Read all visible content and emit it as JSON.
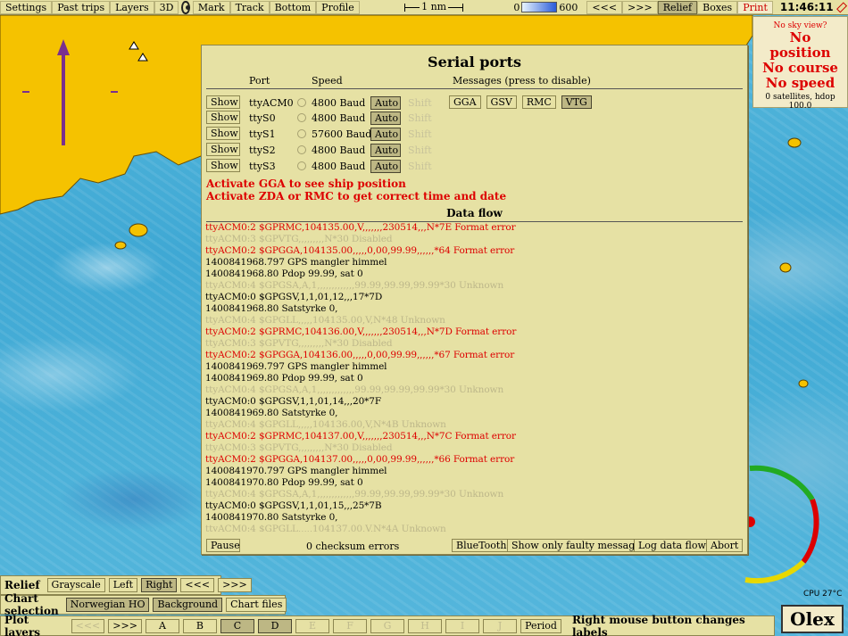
{
  "toolbar": {
    "buttons": [
      "Settings",
      "Past trips",
      "Layers",
      "3D",
      "Mark",
      "Track",
      "Bottom",
      "Profile"
    ],
    "scale_label": "1 nm",
    "depth_min": "0",
    "depth_max": "600",
    "nav_back": "<<<",
    "nav_fwd": ">>>",
    "relief": "Relief",
    "boxes": "Boxes",
    "print": "Print",
    "time": "11:46:11"
  },
  "status": {
    "sky": "No sky view?",
    "line1": "No",
    "line2": "position",
    "line3": "No course",
    "line4": "No speed",
    "satellites": "0 satellites, hdop 100.0"
  },
  "dialog": {
    "title": "Serial ports",
    "headers": {
      "port": "Port",
      "speed": "Speed",
      "messages": "Messages (press to disable)"
    },
    "ports": [
      {
        "show": "Show",
        "name": "ttyACM0",
        "speed": "4800 Baud",
        "auto": "Auto",
        "shift": "Shift"
      },
      {
        "show": "Show",
        "name": "ttyS0",
        "speed": "4800 Baud",
        "auto": "Auto",
        "shift": "Shift"
      },
      {
        "show": "Show",
        "name": "ttyS1",
        "speed": "57600 Baud",
        "auto": "Auto",
        "shift": "Shift"
      },
      {
        "show": "Show",
        "name": "ttyS2",
        "speed": "4800 Baud",
        "auto": "Auto",
        "shift": "Shift"
      },
      {
        "show": "Show",
        "name": "ttyS3",
        "speed": "4800 Baud",
        "auto": "Auto",
        "shift": "Shift"
      }
    ],
    "messages": [
      "GGA",
      "GSV",
      "RMC",
      "VTG"
    ],
    "warning1": "Activate GGA to see ship position",
    "warning2": "Activate ZDA or RMC to get correct time and date",
    "flow_title": "Data flow",
    "flow": [
      {
        "t": "ttyACM0:2 $GPRMC,104135.00,V,,,,,,,230514,,,N*7E  Format error",
        "c": "red"
      },
      {
        "t": "ttyACM0:3 $GPVTG,,,,,,,,,N*30  Disabled",
        "c": "grey"
      },
      {
        "t": "ttyACM0:2 $GPGGA,104135.00,,,,,0,00,99.99,,,,,,*64  Format error",
        "c": "red"
      },
      {
        "t": "1400841968.797 GPS mangler himmel",
        "c": "black"
      },
      {
        "t": "1400841968.80 Pdop 99.99, sat 0",
        "c": "black"
      },
      {
        "t": "ttyACM0:4 $GPGSA,A,1,,,,,,,,,,,,,99.99,99.99,99.99*30  Unknown",
        "c": "grey"
      },
      {
        "t": "ttyACM0:0 $GPGSV,1,1,01,12,,,17*7D",
        "c": "black"
      },
      {
        "t": "1400841968.80 Satstyrke 0,",
        "c": "black"
      },
      {
        "t": "ttyACM0:4 $GPGLL,,,,,104135.00,V,N*48  Unknown",
        "c": "grey"
      },
      {
        "t": "ttyACM0:2 $GPRMC,104136.00,V,,,,,,,230514,,,N*7D  Format error",
        "c": "red"
      },
      {
        "t": "ttyACM0:3 $GPVTG,,,,,,,,,N*30  Disabled",
        "c": "grey"
      },
      {
        "t": "ttyACM0:2 $GPGGA,104136.00,,,,,0,00,99.99,,,,,,*67  Format error",
        "c": "red"
      },
      {
        "t": "1400841969.797 GPS mangler himmel",
        "c": "black"
      },
      {
        "t": "1400841969.80 Pdop 99.99, sat 0",
        "c": "black"
      },
      {
        "t": "ttyACM0:4 $GPGSA,A,1,,,,,,,,,,,,,99.99,99.99,99.99*30  Unknown",
        "c": "grey"
      },
      {
        "t": "ttyACM0:0 $GPGSV,1,1,01,14,,,20*7F",
        "c": "black"
      },
      {
        "t": "1400841969.80 Satstyrke 0,",
        "c": "black"
      },
      {
        "t": "ttyACM0:4 $GPGLL,,,,,104136.00,V,N*4B  Unknown",
        "c": "grey"
      },
      {
        "t": "ttyACM0:2 $GPRMC,104137.00,V,,,,,,,230514,,,N*7C  Format error",
        "c": "red"
      },
      {
        "t": "ttyACM0:3 $GPVTG,,,,,,,,,N*30  Disabled",
        "c": "grey"
      },
      {
        "t": "ttyACM0:2 $GPGGA,104137.00,,,,,0,00,99.99,,,,,,*66  Format error",
        "c": "red"
      },
      {
        "t": "1400841970.797 GPS mangler himmel",
        "c": "black"
      },
      {
        "t": "1400841970.80 Pdop 99.99, sat 0",
        "c": "black"
      },
      {
        "t": "ttyACM0:4 $GPGSA,A,1,,,,,,,,,,,,,99.99,99.99,99.99*30  Unknown",
        "c": "grey"
      },
      {
        "t": "ttyACM0:0 $GPGSV,1,1,01,15,,,25*7B",
        "c": "black"
      },
      {
        "t": "1400841970.80 Satstyrke 0,",
        "c": "black"
      },
      {
        "t": "ttyACM0:4 $GPGLL,,,,,104137.00,V,N*4A  Unknown",
        "c": "grey"
      }
    ],
    "pause": "Pause",
    "checksum": "0 checksum errors",
    "bluetooth": "BlueTooth",
    "faulty": "Show only faulty messages",
    "log": "Log data flow",
    "abort": "Abort"
  },
  "relief_bar": {
    "label": "Relief",
    "grayscale": "Grayscale",
    "left": "Left",
    "right": "Right",
    "back": "<<<",
    "fwd": ">>>"
  },
  "chart_bar": {
    "label": "Chart selection",
    "norwegian": "Norwegian HO",
    "background": "Background",
    "files": "Chart files"
  },
  "plot_bar": {
    "label": "Plot layers",
    "back": "<<<",
    "fwd": ">>>",
    "letters": [
      "A",
      "B",
      "C",
      "D",
      "E",
      "F",
      "G",
      "H",
      "I",
      "J"
    ],
    "period": "Period",
    "hint": "Right mouse button changes labels"
  },
  "cpu": "CPU 27°C",
  "logo": "Olex",
  "colors": {
    "panel": "#e6e1a4",
    "land": "#f5c200",
    "water": "#4fb3d6",
    "warning": "#dd0000"
  }
}
